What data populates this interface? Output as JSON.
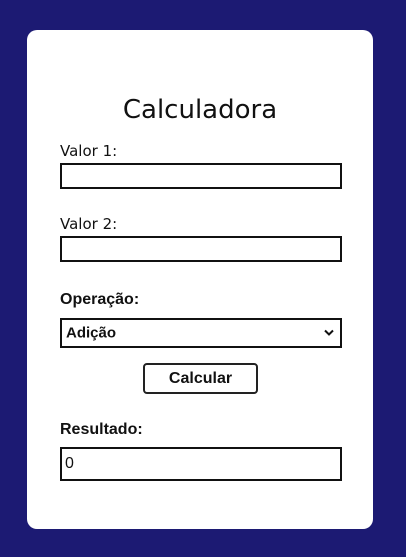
{
  "title": "Calculadora",
  "value1": {
    "label": "Valor 1:",
    "value": ""
  },
  "value2": {
    "label": "Valor 2:",
    "value": ""
  },
  "operation": {
    "label": "Operação:",
    "selected": "Adição",
    "icon": "chevron-down-icon"
  },
  "calculate_button": "Calcular",
  "result": {
    "label": "Resultado:",
    "value": "0"
  },
  "colors": {
    "background": "#1c1a73",
    "card": "#ffffff",
    "text": "#111111",
    "border": "#111111"
  }
}
